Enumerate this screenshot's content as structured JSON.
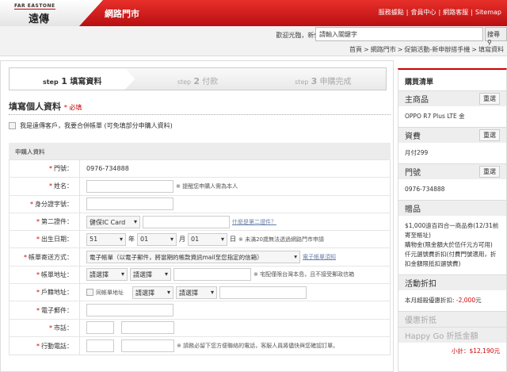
{
  "header": {
    "logo_en": "FAR EASTONE",
    "logo_zh": "遠傳",
    "store": "網路門市",
    "links": [
      "服務據點",
      "會員中心",
      "網路客服",
      "Sitemap"
    ]
  },
  "topbar": {
    "welcome": "歡迎光臨，新使用者? 加入會員 | 登入",
    "search_placeholder": "請輸入關鍵字",
    "search_btn": "搜尋",
    "breadcrumb": [
      "首頁",
      "網路門市",
      "促銷活動-新申辦搭手機",
      "填寫資料"
    ]
  },
  "steps": [
    {
      "step": "step",
      "num": "1",
      "label": "填寫資料"
    },
    {
      "step": "step",
      "num": "2",
      "label": "付款"
    },
    {
      "step": "step",
      "num": "3",
      "label": "申購完成"
    }
  ],
  "form": {
    "title": "填寫個人資料",
    "required": "* 必填",
    "merge_label": "我是遠傳客戶，我要合併帳單 (可免填部分申購人資料)",
    "section": "申購人資料",
    "rows": {
      "phone": {
        "label": "門號：",
        "value": "0976-734888"
      },
      "name": {
        "label": "姓名：",
        "note": "※ 提醒您申購人需為本人"
      },
      "id": {
        "label": "身分證字號："
      },
      "second_id": {
        "label": "第二證件：",
        "select": "健保IC Card",
        "link": "什麼是第二證件？"
      },
      "birth": {
        "label": "出生日期：",
        "year": "51",
        "year_unit": "年",
        "month": "01",
        "month_unit": "月",
        "day": "01",
        "day_unit": "日",
        "note": "※ 未滿20歲無法透過網路門市申請"
      },
      "bill_method": {
        "label": "帳單寄送方式：",
        "select": "電子帳單（以電子郵件，將當期的帳款資訊mail至您指定的信箱）",
        "link": "電子帳單須知"
      },
      "bill_addr": {
        "label": "帳單地址：",
        "sel1": "請選擇",
        "sel2": "請選擇",
        "note": "※ 宅配僅限台灣本島，且不接受郵政信箱"
      },
      "home_addr": {
        "label": "戶籍地址：",
        "same": "同帳單地址",
        "sel1": "請選擇",
        "sel2": "請選擇"
      },
      "email": {
        "label": "電子郵件："
      },
      "tel": {
        "label": "市話："
      },
      "mobile": {
        "label": "行動電話：",
        "note": "※ 請務必留下您方便聯絡的電話，客服人員將儘快與您確認訂單。"
      }
    }
  },
  "cart": {
    "title": "購買清單",
    "reselect": "重選",
    "main_label": "主商品",
    "main": "OPPO R7 Plus LTE 金",
    "plan_label": "資費",
    "plan": "月付299",
    "num_label": "門號",
    "num": "0976-734888",
    "gift_label": "贈品",
    "gifts": [
      "$1,000遠百四合一商品券(12/31前寄至帳址)",
      "購物金(限金額大於伍仟元方可用)",
      "仟元選號費折扣(付費門號適用，折扣金額限抵扣選號費)"
    ],
    "disc_label": "活動折扣",
    "disc_text": "本月超殺優惠折扣:",
    "disc_amt": "-2,000",
    "disc_unit": "元",
    "promo_label": "優惠折抵",
    "hg_label": "Happy Go 折抵金額",
    "subtotal": "小計：$12,190元"
  }
}
